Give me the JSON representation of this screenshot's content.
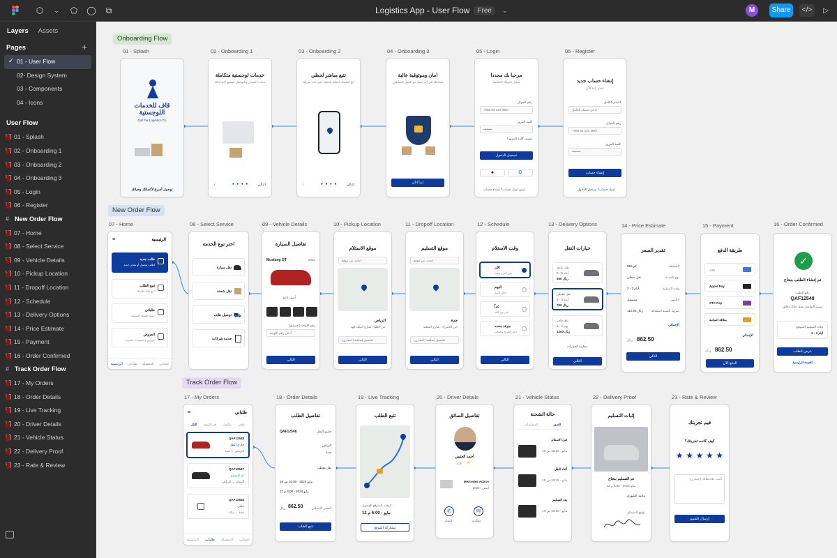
{
  "topbar": {
    "title": "Logistics App - User Flow",
    "badge": "Free",
    "avatar_letter": "M",
    "share_label": "Share",
    "code_label": "</>",
    "icons": [
      "figma-logo-icon",
      "frame-tool-icon",
      "chevron-down-icon",
      "shape-tool-icon",
      "comment-icon",
      "present-icon",
      "chevron-down-icon"
    ]
  },
  "sidebar": {
    "tabs": [
      "Layers",
      "Assets"
    ],
    "pages_label": "Pages",
    "pages": [
      "01 - User Flow",
      "02- Design System",
      "03 - Components",
      "04 - Icons"
    ],
    "layers_title": "User Flow",
    "layers": [
      {
        "type": "frame",
        "label": "01 - Splash"
      },
      {
        "type": "frame",
        "label": "02 - Onboarding 1"
      },
      {
        "type": "frame",
        "label": "03 - Onboarding 2"
      },
      {
        "type": "frame",
        "label": "04 - Onboarding 3"
      },
      {
        "type": "frame",
        "label": "05 - Login"
      },
      {
        "type": "frame",
        "label": "06 - Register"
      },
      {
        "type": "section",
        "label": "New Order Flow"
      },
      {
        "type": "frame",
        "label": "07 - Home"
      },
      {
        "type": "frame",
        "label": "08 - Select Service"
      },
      {
        "type": "frame",
        "label": "09 - Vehicle Details"
      },
      {
        "type": "frame",
        "label": "10 - Pickup Location"
      },
      {
        "type": "frame",
        "label": "11 - Dropoff Location"
      },
      {
        "type": "frame",
        "label": "12 - Schedule"
      },
      {
        "type": "frame",
        "label": "13 - Delivery Options"
      },
      {
        "type": "frame",
        "label": "14 - Price Estimate"
      },
      {
        "type": "frame",
        "label": "15 - Payment"
      },
      {
        "type": "frame",
        "label": "16 - Order Confirmed"
      },
      {
        "type": "section",
        "label": "Track Order Flow"
      },
      {
        "type": "frame",
        "label": "17 - My Orders"
      },
      {
        "type": "frame",
        "label": "18 - Order Details"
      },
      {
        "type": "frame",
        "label": "19 - Live Tracking"
      },
      {
        "type": "frame",
        "label": "20 - Driver Details"
      },
      {
        "type": "frame",
        "label": "21 - Vehicle Status"
      },
      {
        "type": "frame",
        "label": "22 - Delivery Proof"
      },
      {
        "type": "frame",
        "label": "23 - Rate & Review"
      }
    ]
  },
  "canvas": {
    "flows": [
      "Onboarding Flow",
      "New Order Flow",
      "Track Order Flow"
    ],
    "row1": {
      "labels": [
        "01 - Splash",
        "02 - Onboarding 1",
        "03 - Onboarding 2",
        "04 - Onboarding 3",
        "05 - Login",
        "06 - Register"
      ],
      "splash": {
        "brand_ar": "قاف للخدمات اللوجستية",
        "brand_en": "Qaf For Logistics Co",
        "tagline": "توصيل أسرع لأعمالك وحياتك"
      },
      "onb1": {
        "title": "خدمات لوجستية متكاملة",
        "sub": "خدمات الشحن والتوصيل لجميع احتياجاتك"
      },
      "onb2": {
        "title": "تتبع مباشر لحظي",
        "sub": "تابع شحنتك لحظة بلحظة حتى باب منزلك"
      },
      "onb3": {
        "title": "أمان وموثوقية عالية",
        "sub": "شحناتك في أيدٍ أمينة مع أفضل السائقين",
        "cta": "ابدأ الآن"
      },
      "skip": "التالي",
      "login": {
        "title": "مرحباً بك مجدداً",
        "sub": "سجل دخولك للمتابعة",
        "phone_label": "رقم الجوال",
        "phone": "+966 50 123 4567",
        "pass_label": "كلمة المرور",
        "pass": "••••••••",
        "forgot": "نسيت كلمة المرور؟",
        "cta": "تسجيل الدخول",
        "footer": "ليس لديك حساب؟ إنشاء حساب"
      },
      "register": {
        "title": "إنشاء حساب جديد",
        "sub": "انضم إلينا الآن",
        "name_label": "الاسم الكامل",
        "name_ph": "أدخل اسمك الكامل",
        "phone_label": "رقم الجوال",
        "phone": "+966 50 123 4567",
        "pass_label": "كلمة المرور",
        "pass": "••••••••",
        "cta": "إنشاء حساب",
        "footer": "لديك حساب؟ تسجيل الدخول"
      }
    },
    "row2": {
      "labels": [
        "07 - Home",
        "08 - Select Service",
        "09 - Vehicle Details",
        "10 - Pickup Location",
        "11 - Dropoff Location",
        "12 - Schedule",
        "13 - Delivery Options",
        "14 - Price Estimate",
        "15 - Payment",
        "16 - Order Confirmed"
      ],
      "home": {
        "title": "الرئيسية",
        "items": [
          {
            "t": "طلب جديد",
            "s": "اطلب توصيل أو شحن جديد"
          },
          {
            "t": "تتبع الطلب",
            "s": "تابع حالة طلباتك"
          },
          {
            "t": "طلباتي",
            "s": "جميع طلباتك السابقة"
          },
          {
            "t": "العروض",
            "s": "عروض وخصومات حصرية"
          }
        ],
        "nav": [
          "الرئيسية",
          "طلباتي",
          "المفضلة",
          "حسابي"
        ]
      },
      "service": {
        "title": "اختر نوع الخدمة",
        "items": [
          "نقل سيارة",
          "نقل شحنة",
          "توصيل طلب",
          "خدمة شركات"
        ]
      },
      "vehicle": {
        "title": "تفاصيل السيارة",
        "model": "Mustang GT",
        "year": "2023",
        "color": "أسود لامع",
        "plate_label": "رقم اللوحة (اختياري)",
        "plate_ph": "أدخل رقم اللوحة",
        "cta": "التالي"
      },
      "pickup": {
        "title": "موقع الاستلام",
        "search": "ابحث عن موقع",
        "city": "الرياض",
        "addr": "حي العليا - شارع الملك فهد",
        "notes": "تفاصيل إضافية (اختياري)",
        "cta": "التالي"
      },
      "dropoff": {
        "title": "موقع التسليم",
        "search": "ابحث عن موقع",
        "city": "جدة",
        "addr": "حي الحمراء - شارع التحلية",
        "notes": "تفاصيل إضافية (اختياري)",
        "cta": "التالي"
      },
      "schedule": {
        "title": "وقت الاستلام",
        "options": [
          {
            "t": "الآن",
            "s": "في أسرع وقت"
          },
          {
            "t": "اليوم",
            "s": "خلال اليوم"
          },
          {
            "t": "غداً",
            "s": "في يوم الغد"
          },
          {
            "t": "موعد محدد",
            "s": "اختر التاريخ والوقت"
          }
        ],
        "cta": "التالي"
      },
      "delivery": {
        "title": "خيارات النقل",
        "options": [
          {
            "t": "نقل عادي",
            "s": "3 - 5 أيام",
            "p": "450 ريال"
          },
          {
            "t": "نقل مغطى",
            "s": "2 - 3 أيام",
            "p": "750 ريال"
          },
          {
            "t": "نقل فاخر",
            "s": "1 - 2 يوم",
            "p": "1200 ريال"
          }
        ],
        "compare": "مقارنة الخيارات",
        "cta": "التالي"
      },
      "estimate": {
        "title": "تقدير السعر",
        "rows": [
          {
            "k": "المسافة",
            "v": "950 كم"
          },
          {
            "k": "نوع الخدمة",
            "v": "نقل مغطى"
          },
          {
            "k": "وقت التسليم",
            "v": "2 - 3 أيام"
          },
          {
            "k": "التأمين",
            "v": "مشمول"
          },
          {
            "k": "ضريبة القيمة المضافة",
            "v": "112.50 ريال"
          }
        ],
        "total_label": "الإجمالي",
        "total": "862.50",
        "currency": "ريال",
        "cta": "التالي"
      },
      "payment": {
        "title": "طريقة الدفع",
        "methods": [
          "مدى",
          "Apple Pay",
          "STC Pay",
          "بطاقة ائتمانية"
        ],
        "total_label": "الإجمالي",
        "total": "862.50",
        "currency": "ريال",
        "cta": "الدفع الآن"
      },
      "confirmed": {
        "title": "تم إنشاء الطلب بنجاح",
        "order_label": "رقم الطلب",
        "order": "QAF12548",
        "msg": "سيتم التواصل معك خلال دقائق",
        "eta_label": "وقت التسليم المتوقع",
        "eta": "2 - 3 أيام",
        "cta": "عرض الطلب",
        "link": "العودة للرئيسية"
      }
    },
    "row3": {
      "labels": [
        "17 - My Orders",
        "18 - Order Details",
        "19 - Live Tracking",
        "20 - Driver Details",
        "21 - Vehicle Status",
        "22 - Delivery Proof",
        "23 - Rate & Review"
      ],
      "orders": {
        "title": "طلباتي",
        "tabs": [
          "الكل",
          "قيد التنفيذ",
          "مكتمل",
          "ملغي"
        ],
        "items": [
          {
            "id": "QAF12548",
            "st": "جاري النقل",
            "route": "الرياض ← جدة"
          },
          {
            "id": "QAF12547",
            "st": "تم التسليم",
            "route": "الدمام ← الرياض"
          },
          {
            "id": "QAF12546",
            "st": "ملغي",
            "route": "جدة ← مكة"
          }
        ],
        "nav": [
          "الرئيسية",
          "طلباتي",
          "المفضلة",
          "حسابي"
        ]
      },
      "details": {
        "title": "تفاصيل الطلب",
        "id": "QAF12548",
        "status": "جاري النقل",
        "from": "الرياض",
        "to": "جدة",
        "service": "نقل مغطى",
        "date": "10 مايو 2024 - 10:00 ص",
        "eta": "12 مايو 2024 - 6:00 م",
        "price_label": "السعر الإجمالي",
        "price": "862.50",
        "currency": "ريال",
        "cta": "تتبع الطلب"
      },
      "tracking": {
        "title": "تتبع الطلب",
        "eta_label": "الوقت المتوقع للوصول",
        "eta": "12 مايو - 6:00 م",
        "cta": "مشاركة الموقع"
      },
      "driver": {
        "title": "تفاصيل السائق",
        "name": "أحمد العتيبي",
        "rating": "4.8",
        "truck": "Mercedes Actros",
        "truck_sub": "2024 - أبيض",
        "call": "اتصال",
        "chat": "محادثة"
      },
      "vstatus": {
        "title": "حالة الشحنة",
        "tabs": [
          "الصور",
          "المستندات"
        ],
        "sections": [
          "قبل الاستلام",
          "أثناء النقل",
          "بعد التسليم"
        ],
        "time": "10 مايو - 10:15 ص"
      },
      "proof": {
        "title": "إثبات التسليم",
        "done": "تم التسليم بنجاح",
        "date": "12 مايو 2024 - 6:00 م",
        "receiver": "محمد الشهري",
        "signature_label": "توقيع المستلم"
      },
      "review": {
        "title": "قيم تجربتك",
        "question": "كيف كانت تجربتك؟",
        "stars": 5,
        "comment_ph": "أكتب ملاحظاتك (اختياري)",
        "cta": "إرسال التقييم"
      }
    }
  },
  "colors": {
    "primary": "#0f3c9c",
    "figma_dark": "#2c2c2c",
    "canvas": "#f0f0f0",
    "accent": "#0d99ff",
    "success": "#1e9e4a",
    "connector": "#2d8cf0"
  }
}
